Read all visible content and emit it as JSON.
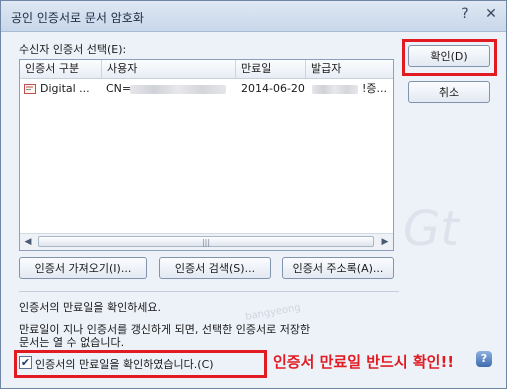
{
  "window": {
    "title": "공인 인증서로 문서 암호화"
  },
  "titlebar": {
    "help_glyph": "?",
    "close_glyph": "✕"
  },
  "recipient": {
    "label": "수신자 인증서 선택(E):"
  },
  "list": {
    "columns": [
      "인증서 구분",
      "사용자",
      "만료일",
      "발급자"
    ],
    "rows": [
      {
        "type": "Digital ...",
        "user": "CN=",
        "expiry": "2014-06-20",
        "issuer_tail": "!증..."
      }
    ]
  },
  "scroll": {
    "left": "◀",
    "right": "▶",
    "grip": "|||"
  },
  "buttons": {
    "ok": "확인(D)",
    "cancel": "취소",
    "import": "인증서 가져오기(I)...",
    "search": "인증서 검색(S)...",
    "addressbook": "인증서 주소록(A)..."
  },
  "info": {
    "line1": "인증서의 만료일을 확인하세요.",
    "line2": "만료일이 지나 인증서를 갱신하게 되면, 선택한 인증서로 저장한",
    "line3": "문서는 열 수 없습니다."
  },
  "checkbox": {
    "label": "인증서의 만료일을 확인하였습니다.(C)",
    "checked": "✔"
  },
  "annotation": {
    "text": "인증서 만료일 반드시 확인!!"
  },
  "help_button": "?",
  "watermark": {
    "mark": "Gt",
    "site": "bangyeong"
  },
  "colors": {
    "highlight": "#e21b22",
    "frame": "#6f86a6",
    "background": "#edf2f8"
  }
}
